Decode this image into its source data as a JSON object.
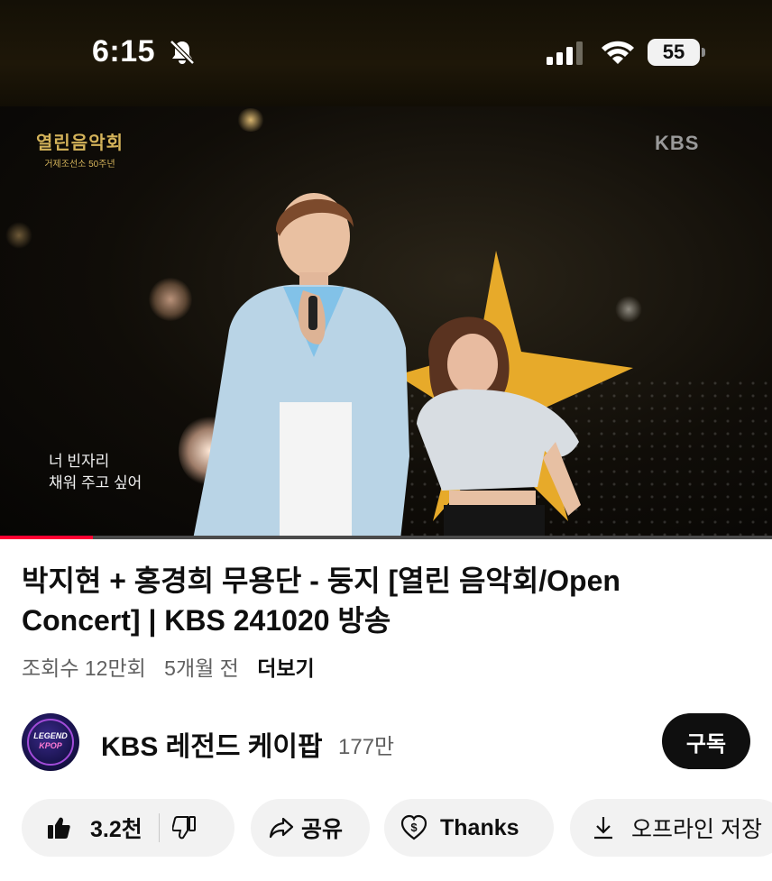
{
  "status_bar": {
    "time": "6:15",
    "battery": "55"
  },
  "video": {
    "show_logo_title": "열린음악회",
    "show_logo_subtitle": "거제조선소 50주년",
    "broadcaster_watermark": "KBS",
    "lyric_line1": "너 빈자리",
    "lyric_line2": "채워 주고 싶어",
    "progress_fraction": 0.12,
    "progress_color": "#ff0033"
  },
  "info": {
    "title": "박지현 + 홍경희 무용단 - 둥지 [열린 음악회/Open Concert] | KBS 241020 방송",
    "views": "조회수 12만회",
    "age": "5개월 전",
    "more_label": "더보기"
  },
  "channel": {
    "avatar_line1": "LEGEND",
    "avatar_line2": "KPOP",
    "name": "KBS 레전드 케이팝",
    "subscribers": "177만",
    "subscribe_label": "구독"
  },
  "actions": {
    "like_count": "3.2천",
    "share_label": "공유",
    "thanks_label": "Thanks",
    "offline_label": "오프라인 저장"
  },
  "icons": [
    "bell-slash-icon",
    "cellular-signal-icon",
    "wifi-icon",
    "battery-icon",
    "thumbs-up-icon",
    "thumbs-down-icon",
    "share-icon",
    "thanks-icon",
    "download-icon"
  ]
}
